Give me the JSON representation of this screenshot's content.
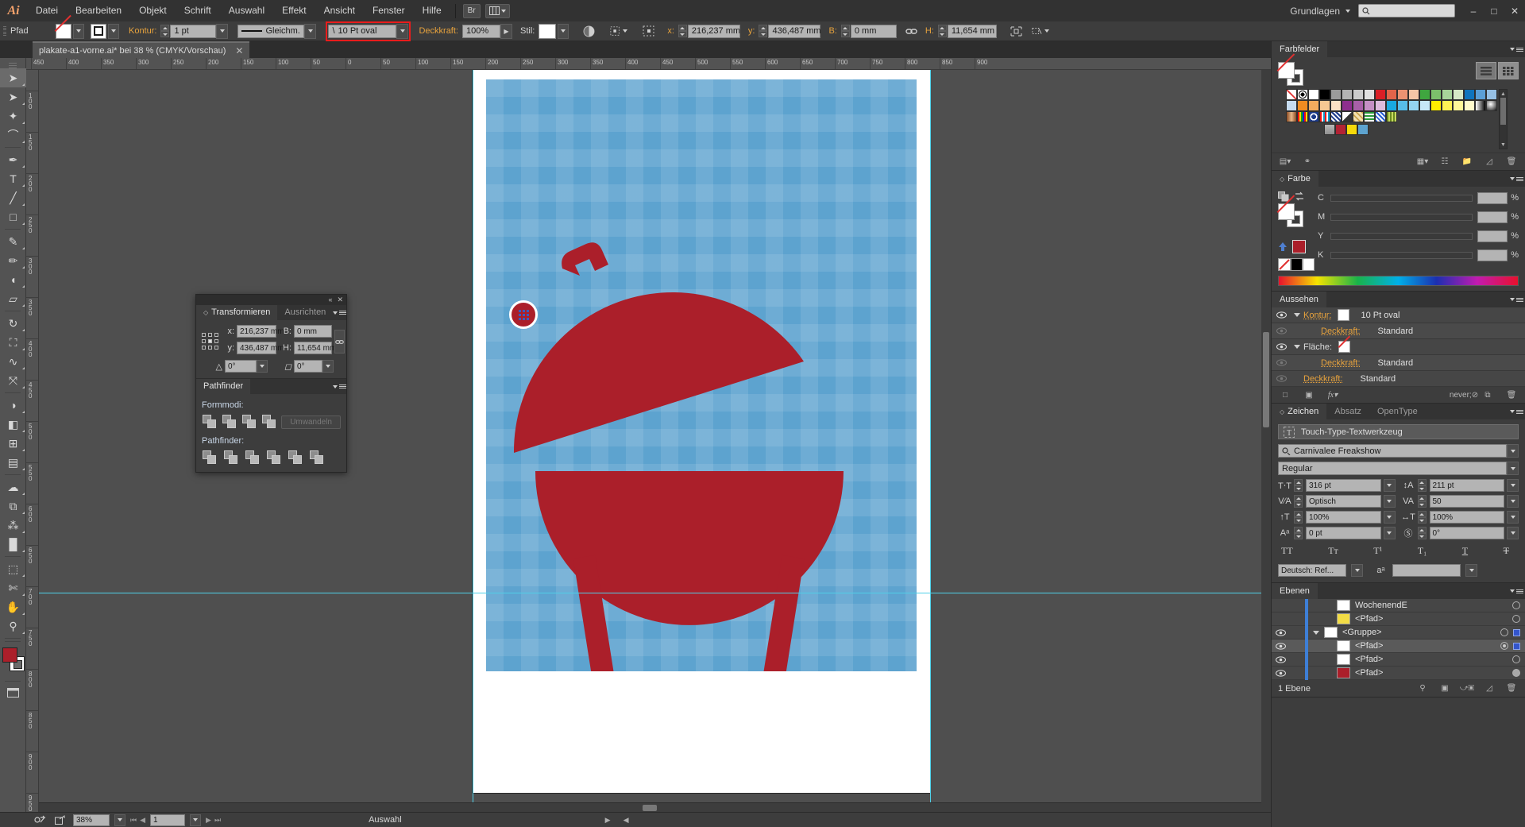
{
  "app": {
    "logo": "Ai",
    "workspace": "Grundlagen",
    "search_placeholder": ""
  },
  "menubar": {
    "items": [
      "Datei",
      "Bearbeiten",
      "Objekt",
      "Schrift",
      "Auswahl",
      "Effekt",
      "Ansicht",
      "Fenster",
      "Hilfe"
    ],
    "bridge_label": "Br",
    "arrange_label": "⌸"
  },
  "window": {
    "minimize": "–",
    "maximize": "□",
    "close": "✕"
  },
  "controlbar": {
    "selection_type": "Pfad",
    "stroke_label": "Kontur:",
    "stroke_weight": "1 pt",
    "stroke_profile": "Gleichm.",
    "brush_definition": "10 Pt oval",
    "opacity_label": "Deckkraft:",
    "opacity_value": "100%",
    "style_label": "Stil:",
    "x_label": "x:",
    "x_value": "216,237 mm",
    "y_label": "y:",
    "y_value": "436,487 mm",
    "w_label": "B:",
    "w_value": "0 mm",
    "h_label": "H:",
    "h_value": "11,654 mm",
    "link_icon": "link-icon"
  },
  "document_tab": {
    "title": "plakate-a1-vorne.ai* bei 38 % (CMYK/Vorschau)",
    "close": "✕"
  },
  "rulers": {
    "horizontal_labels": [
      "450",
      "400",
      "350",
      "300",
      "250",
      "200",
      "150",
      "100",
      "50",
      "0",
      "50",
      "100",
      "150",
      "200",
      "250",
      "300",
      "350",
      "400",
      "450",
      "500",
      "550",
      "600",
      "650",
      "700",
      "750",
      "800",
      "850",
      "900"
    ],
    "vertical_labels": [
      "100",
      "150",
      "200",
      "250",
      "300",
      "350",
      "400",
      "450",
      "500",
      "550",
      "600",
      "650",
      "700",
      "750",
      "800",
      "850",
      "900",
      "950"
    ]
  },
  "toolbox": {
    "tools": [
      {
        "name": "selection-tool",
        "glyph": "➤",
        "selected": true
      },
      {
        "name": "direct-selection-tool",
        "glyph": "➤",
        "selected": false
      },
      {
        "name": "magic-wand-tool",
        "glyph": "✦",
        "selected": false
      },
      {
        "name": "lasso-tool",
        "glyph": "⌒",
        "selected": false
      },
      {
        "name": "pen-tool",
        "glyph": "✒",
        "selected": false
      },
      {
        "name": "type-tool",
        "glyph": "T",
        "selected": false
      },
      {
        "name": "line-segment-tool",
        "glyph": "╱",
        "selected": false
      },
      {
        "name": "rectangle-tool",
        "glyph": "□",
        "selected": false
      },
      {
        "name": "paintbrush-tool",
        "glyph": "✎",
        "selected": false
      },
      {
        "name": "pencil-tool",
        "glyph": "✏",
        "selected": false
      },
      {
        "name": "blob-brush-tool",
        "glyph": "◖",
        "selected": false
      },
      {
        "name": "eraser-tool",
        "glyph": "▱",
        "selected": false
      },
      {
        "name": "rotate-tool",
        "glyph": "↻",
        "selected": false
      },
      {
        "name": "scale-tool",
        "glyph": "⛶",
        "selected": false
      },
      {
        "name": "width-tool",
        "glyph": "∿",
        "selected": false
      },
      {
        "name": "free-transform-tool",
        "glyph": "⤧",
        "selected": false
      },
      {
        "name": "shape-builder-tool",
        "glyph": "◑",
        "selected": false
      },
      {
        "name": "perspective-grid-tool",
        "glyph": "◧",
        "selected": false
      },
      {
        "name": "mesh-tool",
        "glyph": "⊞",
        "selected": false
      },
      {
        "name": "gradient-tool",
        "glyph": "▤",
        "selected": false
      },
      {
        "name": "eyedropper-tool",
        "glyph": "☁",
        "selected": false
      },
      {
        "name": "blend-tool",
        "glyph": "⧉",
        "selected": false
      },
      {
        "name": "symbol-sprayer-tool",
        "glyph": "⁂",
        "selected": false
      },
      {
        "name": "column-graph-tool",
        "glyph": "█",
        "selected": false
      },
      {
        "name": "artboard-tool",
        "glyph": "⬚",
        "selected": false
      },
      {
        "name": "slice-tool",
        "glyph": "✄",
        "selected": false
      },
      {
        "name": "hand-tool",
        "glyph": "✋",
        "selected": false
      },
      {
        "name": "zoom-tool",
        "glyph": "⚲",
        "selected": false
      }
    ]
  },
  "transform_panel": {
    "tabs": [
      "Transformieren",
      "Ausrichten"
    ],
    "active_tab": "Transformieren",
    "x_label": "x:",
    "x_value": "216,237 mm",
    "y_label": "y:",
    "y_value": "436,487 mm",
    "w_label": "B:",
    "w_value": "0 mm",
    "h_label": "H:",
    "h_value": "11,654 mm",
    "rotate_value": "0°",
    "shear_value": "0°"
  },
  "pathfinder_panel": {
    "tab": "Pathfinder",
    "shape_modes_label": "Formmodi:",
    "expand_button": "Umwandeln",
    "pathfinders_label": "Pathfinder:"
  },
  "swatches_panel": {
    "tab": "Farbfelder",
    "colors_row1": [
      "none",
      "registration",
      "#ffffff",
      "#000000",
      "#9b9b9b",
      "#b4b4b4",
      "#cccccc",
      "#e0e0e0",
      "#d91f26",
      "#e2644a",
      "#eb9272",
      "#f5c4a6",
      "#3fa63f",
      "#7cbf6b",
      "#a8d49a",
      "#d6e9c6",
      "#0f74bd",
      "#5b9fd6",
      "#96c0e4",
      "#c6dcf0"
    ],
    "colors_row2": [
      "#ef8b21",
      "#f2ab5e",
      "#f7c893",
      "#fbe0c4",
      "#8e2f8e",
      "#a85fa8",
      "#c48fc4",
      "#ddbbdd",
      "#19a8e0",
      "#57bce8",
      "#93d3f0",
      "#c6e7f7",
      "#ffed00",
      "#fff255",
      "#fff799",
      "#fffbcc",
      "#gradient-bw",
      "#gradient-sphere",
      "#gradient-copper",
      "#pattern-rainbow"
    ],
    "colors_row3": [
      "#pattern-eye",
      "#pattern-stripe",
      "#pattern-dot",
      "#gradient-gray",
      "#pattern-leopard",
      "#pattern-green",
      "#pattern-blue",
      "#pattern-olive"
    ],
    "colors_row4": [
      "#folder",
      "#b22234",
      "#f5d90a",
      "#5da3cf"
    ]
  },
  "color_panel": {
    "tab": "Farbe",
    "channels": [
      "C",
      "M",
      "Y",
      "K"
    ],
    "values": [
      "",
      "",
      "",
      ""
    ],
    "percent": "%"
  },
  "appearance_panel": {
    "tab": "Aussehen",
    "rows": [
      {
        "name": "Kontur:",
        "value": "10 Pt oval",
        "indent": 0,
        "eye": true,
        "tri": true,
        "swatch": "white",
        "orange": true
      },
      {
        "name": "Deckkraft:",
        "value": "Standard",
        "indent": 1,
        "eye": false,
        "tri": false,
        "swatch": "",
        "orange": true
      },
      {
        "name": "Fläche:",
        "value": "",
        "indent": 0,
        "eye": true,
        "tri": true,
        "swatch": "none",
        "orange": false
      },
      {
        "name": "Deckkraft:",
        "value": "Standard",
        "indent": 1,
        "eye": false,
        "tri": false,
        "swatch": "",
        "orange": true
      },
      {
        "name": "Deckkraft:",
        "value": "Standard",
        "indent": 0,
        "eye": false,
        "tri": false,
        "swatch": "",
        "orange": true
      }
    ]
  },
  "character_panel": {
    "tabs": [
      "Zeichen",
      "Absatz",
      "OpenType"
    ],
    "active_tab": "Zeichen",
    "touch_type_label": "Touch-Type-Textwerkzeug",
    "font_family": "Carnivalee Freakshow",
    "font_style": "Regular",
    "font_size": "316 pt",
    "leading": "211 pt",
    "kerning": "Optisch",
    "tracking": "50",
    "vertical_scale": "100%",
    "horizontal_scale": "100%",
    "baseline_shift": "0 pt",
    "character_rotation": "0°",
    "language": "Deutsch: Ref...",
    "anti_alias": "",
    "style_buttons": [
      "TT",
      "Tᴛ",
      "T¹",
      "T₁",
      "T",
      "T"
    ]
  },
  "layers_panel": {
    "tab": "Ebenen",
    "rows": [
      {
        "name": "WochenendE",
        "eye": false,
        "indent": 2,
        "thumb": "#ffffff",
        "target": "hollow",
        "selected_square": false,
        "tri": false
      },
      {
        "name": "<Pfad>",
        "eye": false,
        "indent": 2,
        "thumb": "#f2dc45",
        "target": "hollow",
        "selected_square": false,
        "tri": false
      },
      {
        "name": "<Gruppe>",
        "eye": true,
        "indent": 1,
        "thumb": "#ffffff",
        "target": "hollow",
        "selected_square": true,
        "tri": true
      },
      {
        "name": "<Pfad>",
        "eye": true,
        "indent": 2,
        "thumb": "#ffffff",
        "target": "ring",
        "selected_square": true,
        "tri": false
      },
      {
        "name": "<Pfad>",
        "eye": true,
        "indent": 2,
        "thumb": "#ffffff",
        "target": "hollow",
        "selected_square": false,
        "tri": false
      },
      {
        "name": "<Pfad>",
        "eye": true,
        "indent": 2,
        "thumb": "#ab1f2a",
        "target": "filled",
        "selected_square": false,
        "tri": false
      }
    ],
    "footer_count": "1 Ebene"
  },
  "statusbar": {
    "zoom": "38%",
    "page": "1",
    "status_text": "Auswahl"
  },
  "artwork": {
    "description": "BBQ grill poster",
    "background_color": "#5da3cf",
    "grill_color": "#ab1f2a",
    "paper_color": "#ffffff"
  }
}
